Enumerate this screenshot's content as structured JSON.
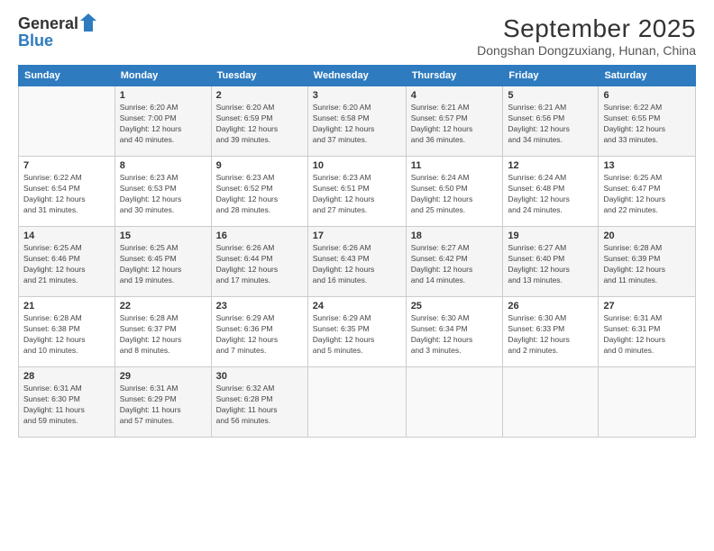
{
  "header": {
    "logo_line1": "General",
    "logo_line2": "Blue",
    "month": "September 2025",
    "location": "Dongshan Dongzuxiang, Hunan, China"
  },
  "weekdays": [
    "Sunday",
    "Monday",
    "Tuesday",
    "Wednesday",
    "Thursday",
    "Friday",
    "Saturday"
  ],
  "weeks": [
    [
      {
        "day": "",
        "info": ""
      },
      {
        "day": "1",
        "info": "Sunrise: 6:20 AM\nSunset: 7:00 PM\nDaylight: 12 hours\nand 40 minutes."
      },
      {
        "day": "2",
        "info": "Sunrise: 6:20 AM\nSunset: 6:59 PM\nDaylight: 12 hours\nand 39 minutes."
      },
      {
        "day": "3",
        "info": "Sunrise: 6:20 AM\nSunset: 6:58 PM\nDaylight: 12 hours\nand 37 minutes."
      },
      {
        "day": "4",
        "info": "Sunrise: 6:21 AM\nSunset: 6:57 PM\nDaylight: 12 hours\nand 36 minutes."
      },
      {
        "day": "5",
        "info": "Sunrise: 6:21 AM\nSunset: 6:56 PM\nDaylight: 12 hours\nand 34 minutes."
      },
      {
        "day": "6",
        "info": "Sunrise: 6:22 AM\nSunset: 6:55 PM\nDaylight: 12 hours\nand 33 minutes."
      }
    ],
    [
      {
        "day": "7",
        "info": "Sunrise: 6:22 AM\nSunset: 6:54 PM\nDaylight: 12 hours\nand 31 minutes."
      },
      {
        "day": "8",
        "info": "Sunrise: 6:23 AM\nSunset: 6:53 PM\nDaylight: 12 hours\nand 30 minutes."
      },
      {
        "day": "9",
        "info": "Sunrise: 6:23 AM\nSunset: 6:52 PM\nDaylight: 12 hours\nand 28 minutes."
      },
      {
        "day": "10",
        "info": "Sunrise: 6:23 AM\nSunset: 6:51 PM\nDaylight: 12 hours\nand 27 minutes."
      },
      {
        "day": "11",
        "info": "Sunrise: 6:24 AM\nSunset: 6:50 PM\nDaylight: 12 hours\nand 25 minutes."
      },
      {
        "day": "12",
        "info": "Sunrise: 6:24 AM\nSunset: 6:48 PM\nDaylight: 12 hours\nand 24 minutes."
      },
      {
        "day": "13",
        "info": "Sunrise: 6:25 AM\nSunset: 6:47 PM\nDaylight: 12 hours\nand 22 minutes."
      }
    ],
    [
      {
        "day": "14",
        "info": "Sunrise: 6:25 AM\nSunset: 6:46 PM\nDaylight: 12 hours\nand 21 minutes."
      },
      {
        "day": "15",
        "info": "Sunrise: 6:25 AM\nSunset: 6:45 PM\nDaylight: 12 hours\nand 19 minutes."
      },
      {
        "day": "16",
        "info": "Sunrise: 6:26 AM\nSunset: 6:44 PM\nDaylight: 12 hours\nand 17 minutes."
      },
      {
        "day": "17",
        "info": "Sunrise: 6:26 AM\nSunset: 6:43 PM\nDaylight: 12 hours\nand 16 minutes."
      },
      {
        "day": "18",
        "info": "Sunrise: 6:27 AM\nSunset: 6:42 PM\nDaylight: 12 hours\nand 14 minutes."
      },
      {
        "day": "19",
        "info": "Sunrise: 6:27 AM\nSunset: 6:40 PM\nDaylight: 12 hours\nand 13 minutes."
      },
      {
        "day": "20",
        "info": "Sunrise: 6:28 AM\nSunset: 6:39 PM\nDaylight: 12 hours\nand 11 minutes."
      }
    ],
    [
      {
        "day": "21",
        "info": "Sunrise: 6:28 AM\nSunset: 6:38 PM\nDaylight: 12 hours\nand 10 minutes."
      },
      {
        "day": "22",
        "info": "Sunrise: 6:28 AM\nSunset: 6:37 PM\nDaylight: 12 hours\nand 8 minutes."
      },
      {
        "day": "23",
        "info": "Sunrise: 6:29 AM\nSunset: 6:36 PM\nDaylight: 12 hours\nand 7 minutes."
      },
      {
        "day": "24",
        "info": "Sunrise: 6:29 AM\nSunset: 6:35 PM\nDaylight: 12 hours\nand 5 minutes."
      },
      {
        "day": "25",
        "info": "Sunrise: 6:30 AM\nSunset: 6:34 PM\nDaylight: 12 hours\nand 3 minutes."
      },
      {
        "day": "26",
        "info": "Sunrise: 6:30 AM\nSunset: 6:33 PM\nDaylight: 12 hours\nand 2 minutes."
      },
      {
        "day": "27",
        "info": "Sunrise: 6:31 AM\nSunset: 6:31 PM\nDaylight: 12 hours\nand 0 minutes."
      }
    ],
    [
      {
        "day": "28",
        "info": "Sunrise: 6:31 AM\nSunset: 6:30 PM\nDaylight: 11 hours\nand 59 minutes."
      },
      {
        "day": "29",
        "info": "Sunrise: 6:31 AM\nSunset: 6:29 PM\nDaylight: 11 hours\nand 57 minutes."
      },
      {
        "day": "30",
        "info": "Sunrise: 6:32 AM\nSunset: 6:28 PM\nDaylight: 11 hours\nand 56 minutes."
      },
      {
        "day": "",
        "info": ""
      },
      {
        "day": "",
        "info": ""
      },
      {
        "day": "",
        "info": ""
      },
      {
        "day": "",
        "info": ""
      }
    ]
  ]
}
